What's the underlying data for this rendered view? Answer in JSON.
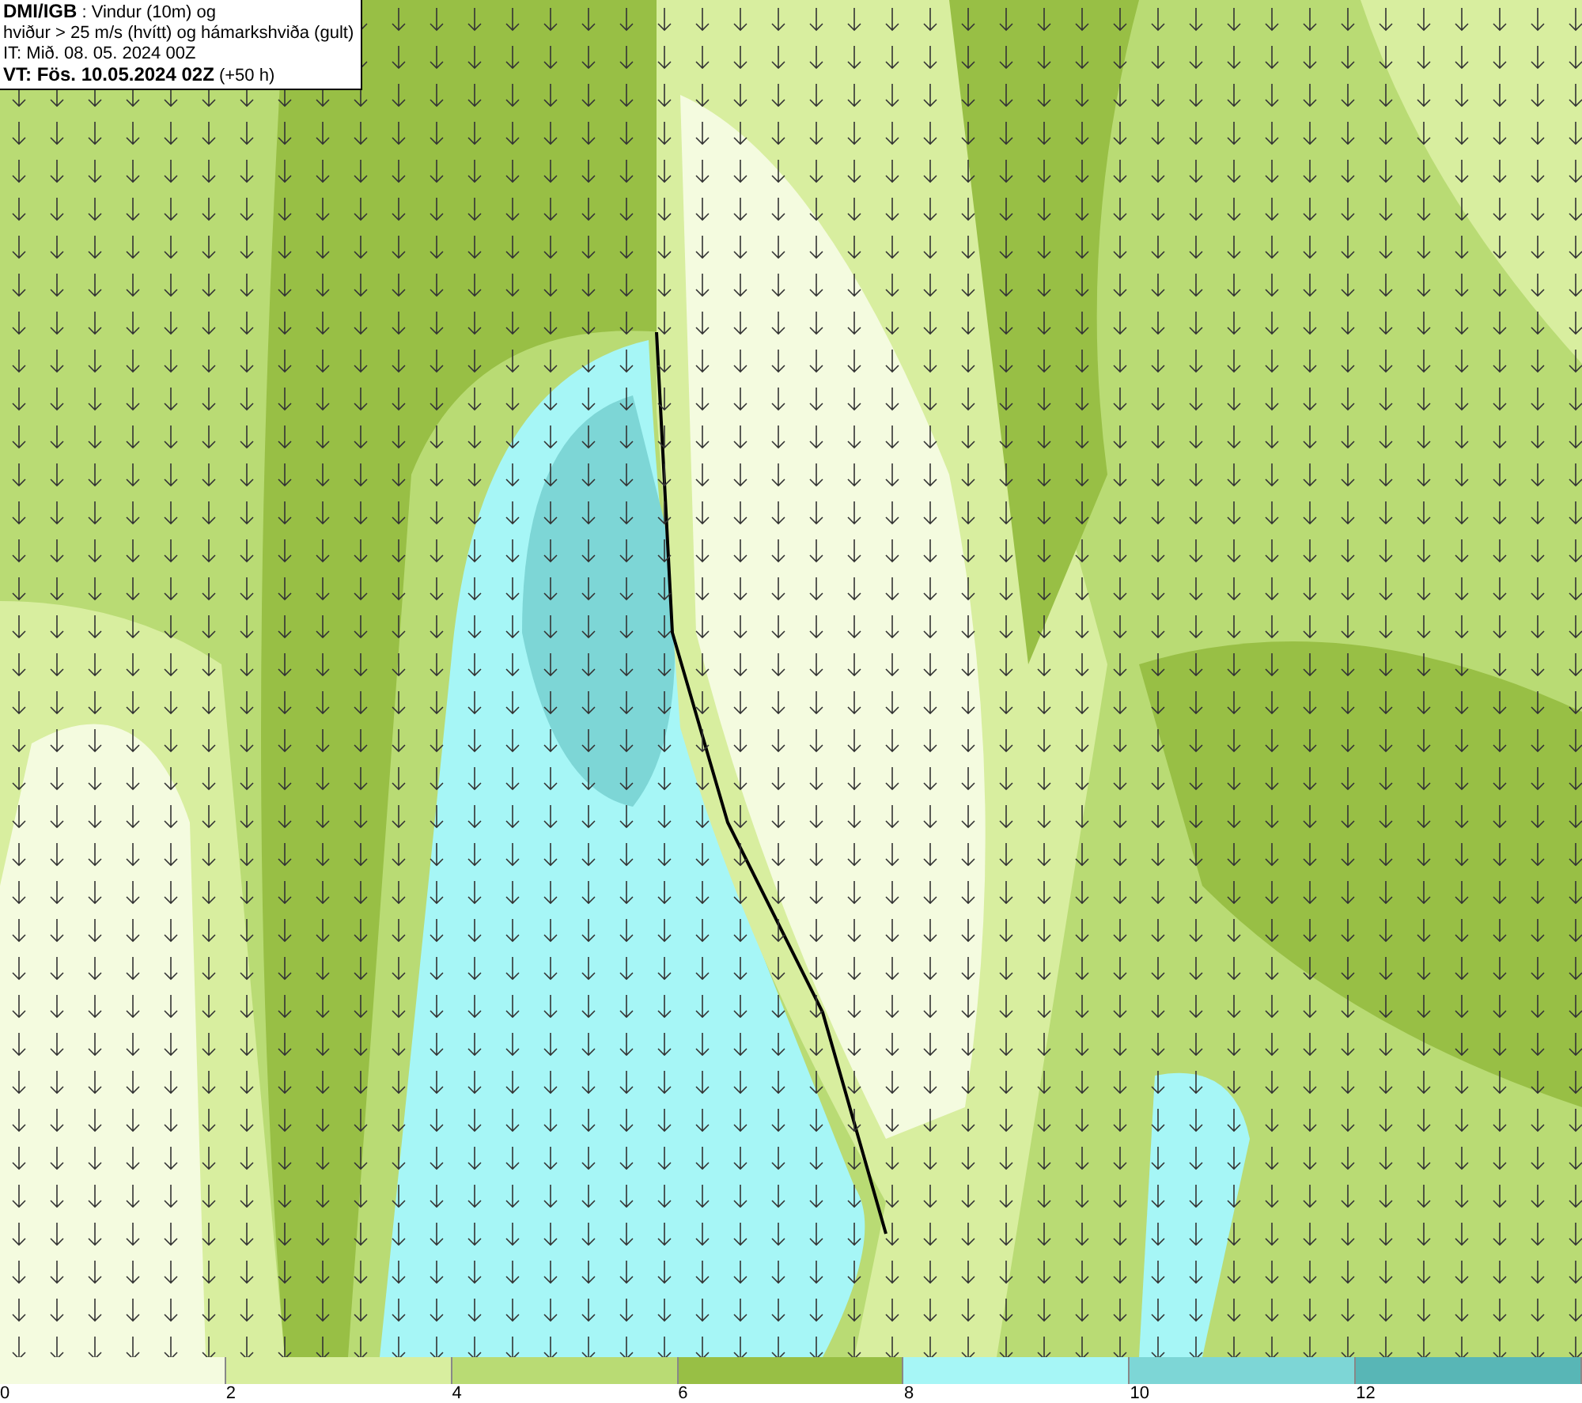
{
  "title_box": {
    "lines": [
      "**DMI/IGB** : Vindur (10m) og",
      "hviður > 25 m/s (hvítt) og hámarkshviða (gult)",
      "IT: Mið. 08. 05. 2024 00Z",
      "**VT: Fös. 10.05.2024 02Z** (+50 h)"
    ]
  },
  "legend": {
    "bins": [
      {
        "color": "#f4fbdf",
        "label": "0"
      },
      {
        "color": "#d8ee9f",
        "label": "2"
      },
      {
        "color": "#b9db74",
        "label": "4"
      },
      {
        "color": "#98bf45",
        "label": "6"
      },
      {
        "color": "#a6f6f6",
        "label": "8"
      },
      {
        "color": "#7dd6d6",
        "label": "10"
      },
      {
        "color": "#58b6b6",
        "label": "12"
      }
    ]
  }
}
